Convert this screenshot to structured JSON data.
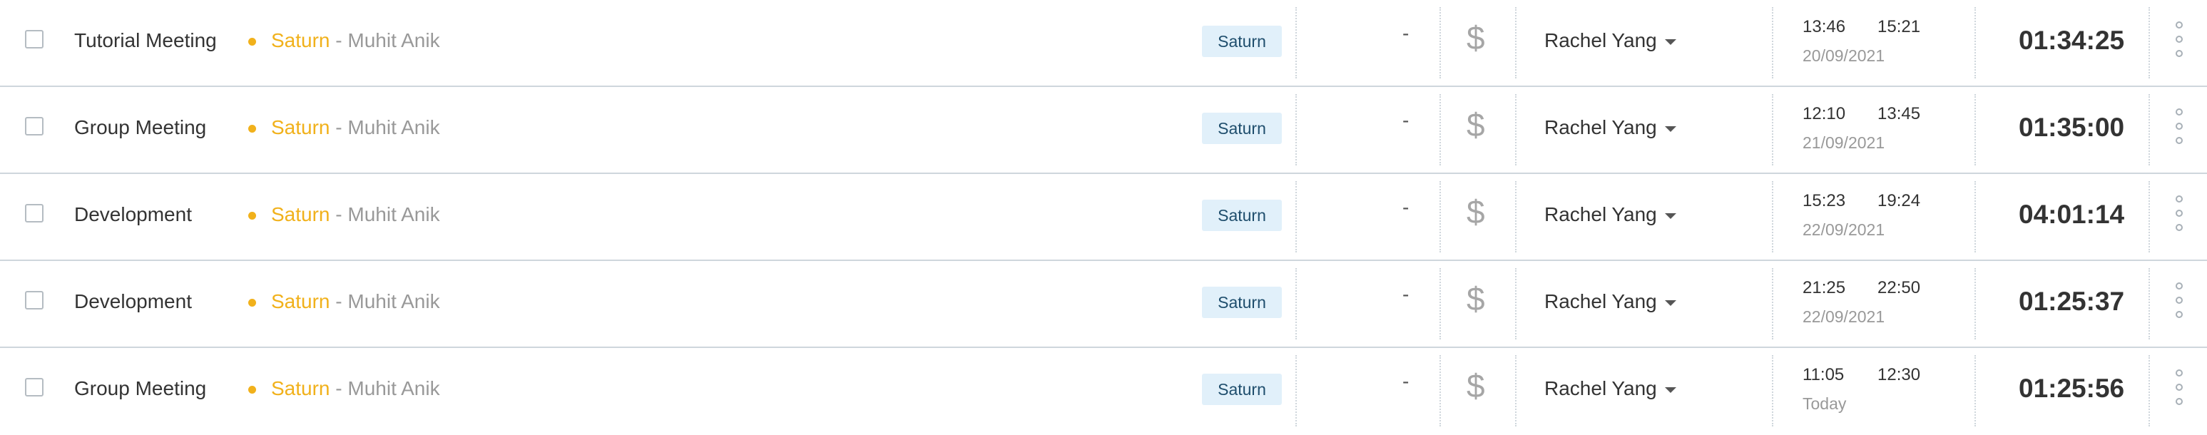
{
  "columns": {
    "billable_icon": "dollar-icon",
    "more_icon": "kebab-menu-icon",
    "dropdown_icon": "caret-down-icon"
  },
  "colors": {
    "project_accent": "#f1b11b",
    "tag_background": "#e1f0fa",
    "tag_text": "#1f4e6d"
  },
  "entries": [
    {
      "description": "Tutorial Meeting",
      "project": "Saturn",
      "separator": " - ",
      "client": "Muhit Anik",
      "tag": "Saturn",
      "dash": "-",
      "billable_symbol": "$",
      "user": "Rachel Yang",
      "start_time": "13:46",
      "end_time": "15:21",
      "date": "20/09/2021",
      "duration": "01:34:25"
    },
    {
      "description": "Group Meeting",
      "project": "Saturn",
      "separator": " - ",
      "client": "Muhit Anik",
      "tag": "Saturn",
      "dash": "-",
      "billable_symbol": "$",
      "user": "Rachel Yang",
      "start_time": "12:10",
      "end_time": "13:45",
      "date": "21/09/2021",
      "duration": "01:35:00"
    },
    {
      "description": "Development",
      "project": "Saturn",
      "separator": " - ",
      "client": "Muhit Anik",
      "tag": "Saturn",
      "dash": "-",
      "billable_symbol": "$",
      "user": "Rachel Yang",
      "start_time": "15:23",
      "end_time": "19:24",
      "date": "22/09/2021",
      "duration": "04:01:14"
    },
    {
      "description": "Development",
      "project": "Saturn",
      "separator": " - ",
      "client": "Muhit Anik",
      "tag": "Saturn",
      "dash": "-",
      "billable_symbol": "$",
      "user": "Rachel Yang",
      "start_time": "21:25",
      "end_time": "22:50",
      "date": "22/09/2021",
      "duration": "01:25:37"
    },
    {
      "description": "Group Meeting",
      "project": "Saturn",
      "separator": " - ",
      "client": "Muhit Anik",
      "tag": "Saturn",
      "dash": "-",
      "billable_symbol": "$",
      "user": "Rachel Yang",
      "start_time": "11:05",
      "end_time": "12:30",
      "date": "Today",
      "duration": "01:25:56"
    }
  ]
}
